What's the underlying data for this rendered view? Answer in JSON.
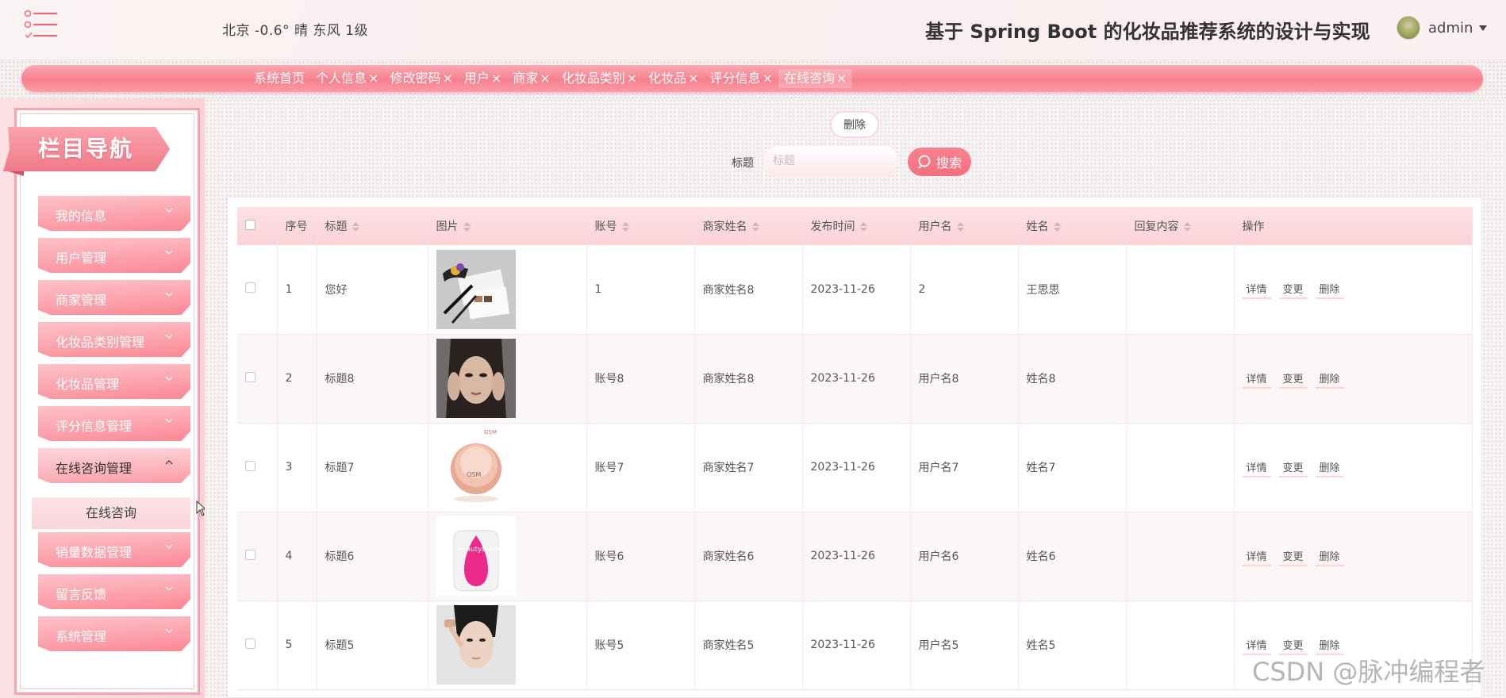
{
  "header": {
    "weather": "北京  -0.6°  晴  东风  1级",
    "title": "基于 Spring Boot 的化妆品推荐系统的设计与实现",
    "user_name": "admin"
  },
  "tabs": [
    {
      "label": "系统首页",
      "closable": false,
      "active": false
    },
    {
      "label": "个人信息",
      "closable": true,
      "active": false
    },
    {
      "label": "修改密码",
      "closable": true,
      "active": false
    },
    {
      "label": "用户",
      "closable": true,
      "active": false
    },
    {
      "label": "商家",
      "closable": true,
      "active": false
    },
    {
      "label": "化妆品类别",
      "closable": true,
      "active": false
    },
    {
      "label": "化妆品",
      "closable": true,
      "active": false
    },
    {
      "label": "评分信息",
      "closable": true,
      "active": false
    },
    {
      "label": "在线咨询",
      "closable": true,
      "active": true
    }
  ],
  "tab_close_glyph": "×",
  "sidebar": {
    "banner": "栏目导航",
    "items": [
      {
        "label": "我的信息",
        "open": false
      },
      {
        "label": "用户管理",
        "open": false
      },
      {
        "label": "商家管理",
        "open": false
      },
      {
        "label": "化妆品类别管理",
        "open": false
      },
      {
        "label": "化妆品管理",
        "open": false
      },
      {
        "label": "评分信息管理",
        "open": false
      },
      {
        "label": "在线咨询管理",
        "open": true
      },
      {
        "label": "销量数据管理",
        "open": false
      },
      {
        "label": "留言反馈",
        "open": false
      },
      {
        "label": "系统管理",
        "open": false
      }
    ],
    "submenu": "在线咨询"
  },
  "toolbar": {
    "delete_label": "删除",
    "search_label": "标题",
    "search_placeholder": "标题",
    "search_button": "搜索"
  },
  "table": {
    "columns": [
      {
        "label": "序号",
        "sortable": false
      },
      {
        "label": "标题",
        "sortable": true
      },
      {
        "label": "图片",
        "sortable": true
      },
      {
        "label": "账号",
        "sortable": true
      },
      {
        "label": "商家姓名",
        "sortable": true
      },
      {
        "label": "发布时间",
        "sortable": true
      },
      {
        "label": "用户名",
        "sortable": true
      },
      {
        "label": "姓名",
        "sortable": true
      },
      {
        "label": "回复内容",
        "sortable": true
      },
      {
        "label": "操作",
        "sortable": false
      }
    ],
    "rows": [
      {
        "index": "1",
        "title": "您好",
        "image": "makeup-brushes-photo",
        "account": "1",
        "merchant": "商家姓名8",
        "time": "2023-11-26",
        "username": "2",
        "name": "王思思",
        "reply": ""
      },
      {
        "index": "2",
        "title": "标题8",
        "image": "model-portrait-photo",
        "account": "账号8",
        "merchant": "商家姓名8",
        "time": "2023-11-26",
        "username": "用户名8",
        "name": "姓名8",
        "reply": ""
      },
      {
        "index": "3",
        "title": "标题7",
        "image": "cream-jar-photo",
        "account": "账号7",
        "merchant": "商家姓名7",
        "time": "2023-11-26",
        "username": "用户名7",
        "name": "姓名7",
        "reply": ""
      },
      {
        "index": "4",
        "title": "标题6",
        "image": "beauty-blender-photo",
        "account": "账号6",
        "merchant": "商家姓名6",
        "time": "2023-11-26",
        "username": "用户名6",
        "name": "姓名6",
        "reply": ""
      },
      {
        "index": "5",
        "title": "标题5",
        "image": "skincare-model-photo",
        "account": "账号5",
        "merchant": "商家姓名5",
        "time": "2023-11-26",
        "username": "用户名5",
        "name": "姓名5",
        "reply": ""
      }
    ],
    "actions": [
      "详情",
      "变更",
      "删除"
    ]
  },
  "watermark": "CSDN @脉冲编程者",
  "colors": {
    "accent": "#f7808e",
    "accent_light": "#fde2e5",
    "header_bg": "#faf3f3"
  }
}
